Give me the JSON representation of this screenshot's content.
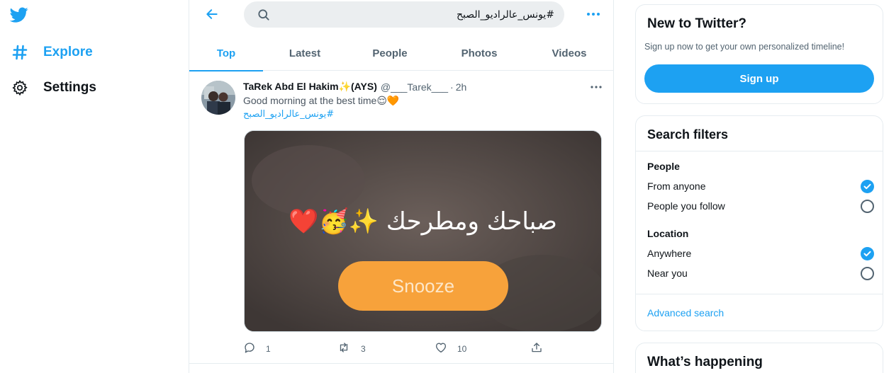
{
  "nav": {
    "logo_icon": "twitter-bird-icon",
    "items": [
      {
        "label": "Explore",
        "icon": "hashtag-icon",
        "active": true
      },
      {
        "label": "Settings",
        "icon": "gear-icon",
        "active": false
      }
    ]
  },
  "search": {
    "value": "#يونس_عالراديو_الصبح",
    "icon": "search-icon"
  },
  "tabs": [
    {
      "label": "Top",
      "active": true
    },
    {
      "label": "Latest",
      "active": false
    },
    {
      "label": "People",
      "active": false
    },
    {
      "label": "Photos",
      "active": false
    },
    {
      "label": "Videos",
      "active": false
    }
  ],
  "tweet": {
    "name": "TaRek Abd El Hakim✨(AYS)",
    "handle": "@___Tarek___",
    "separator": "·",
    "time": "2h",
    "text": "Good morning at the best time😌🧡",
    "hashtag": "#يونس_عالراديو_الصبح",
    "media": {
      "text": "صباحك ومطرحك ✨🥳❤️",
      "button": "Snooze"
    },
    "replies": "1",
    "retweets": "3",
    "likes": "10"
  },
  "sidebar": {
    "new": {
      "title": "New to Twitter?",
      "subtitle": "Sign up now to get your own personalized timeline!",
      "button": "Sign up"
    },
    "filters": {
      "title": "Search filters",
      "people_label": "People",
      "people_options": [
        {
          "label": "From anyone",
          "selected": true
        },
        {
          "label": "People you follow",
          "selected": false
        }
      ],
      "location_label": "Location",
      "location_options": [
        {
          "label": "Anywhere",
          "selected": true
        },
        {
          "label": "Near you",
          "selected": false
        }
      ],
      "advanced": "Advanced search"
    },
    "happening": {
      "title": "What’s happening"
    }
  },
  "colors": {
    "accent": "#1da1f2",
    "text": "#0f1419",
    "muted": "#536471",
    "border": "#e6ecf0"
  }
}
